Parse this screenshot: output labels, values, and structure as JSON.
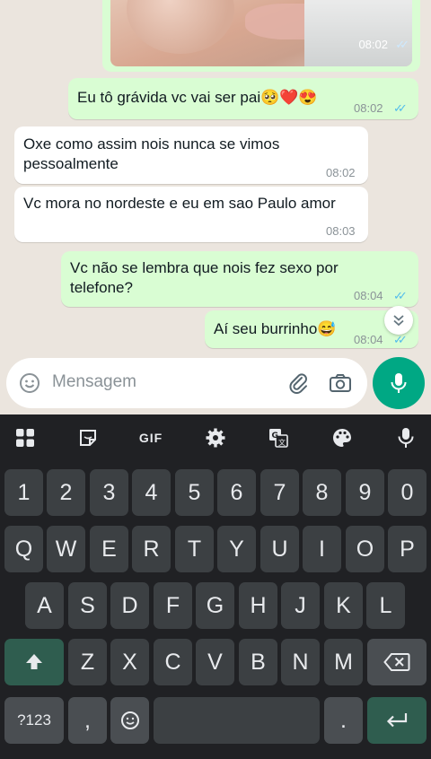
{
  "chat": {
    "photo_message": {
      "time": "08:02",
      "status": "read"
    },
    "messages": [
      {
        "direction": "out",
        "text": "Eu tô grávida vc vai ser pai🥺❤️😍",
        "time": "08:02",
        "status": "read"
      },
      {
        "direction": "in",
        "text": "Oxe como assim nois nunca se vimos pessoalmente",
        "time": "08:02"
      },
      {
        "direction": "in",
        "text": "Vc mora no nordeste e eu em sao Paulo amor",
        "time": "08:03"
      },
      {
        "direction": "out",
        "text": "Vc não se lembra que nois fez sexo por telefone?",
        "time": "08:04",
        "status": "read"
      },
      {
        "direction": "out",
        "text": "Aí seu burrinho😅",
        "time": "08:04",
        "status": "read"
      }
    ],
    "read_ticks": "✓✓"
  },
  "composer": {
    "placeholder": "Mensagem",
    "icons": [
      "emoji-icon",
      "paperclip-icon",
      "camera-icon",
      "microphone-icon"
    ]
  },
  "keyboard": {
    "toolbar": {
      "gif_label": "GIF",
      "icons": [
        "apps-grid-icon",
        "sticker-icon",
        "gear-icon",
        "translate-icon",
        "palette-icon",
        "microphone-icon"
      ]
    },
    "row_numbers": [
      "1",
      "2",
      "3",
      "4",
      "5",
      "6",
      "7",
      "8",
      "9",
      "0"
    ],
    "row_q": [
      "Q",
      "W",
      "E",
      "R",
      "T",
      "Y",
      "U",
      "I",
      "O",
      "P"
    ],
    "row_a": [
      "A",
      "S",
      "D",
      "F",
      "G",
      "H",
      "J",
      "K",
      "L"
    ],
    "row_z": [
      "Z",
      "X",
      "C",
      "V",
      "B",
      "N",
      "M"
    ],
    "symbols_label": "?123",
    "comma_label": ",",
    "period_label": "."
  },
  "colors": {
    "outgoing_bubble": "#d9fdd3",
    "incoming_bubble": "#ffffff",
    "chat_background": "#ebe5de",
    "mic_button": "#00a884",
    "read_ticks": "#53bdeb",
    "keyboard_background": "#202124"
  }
}
